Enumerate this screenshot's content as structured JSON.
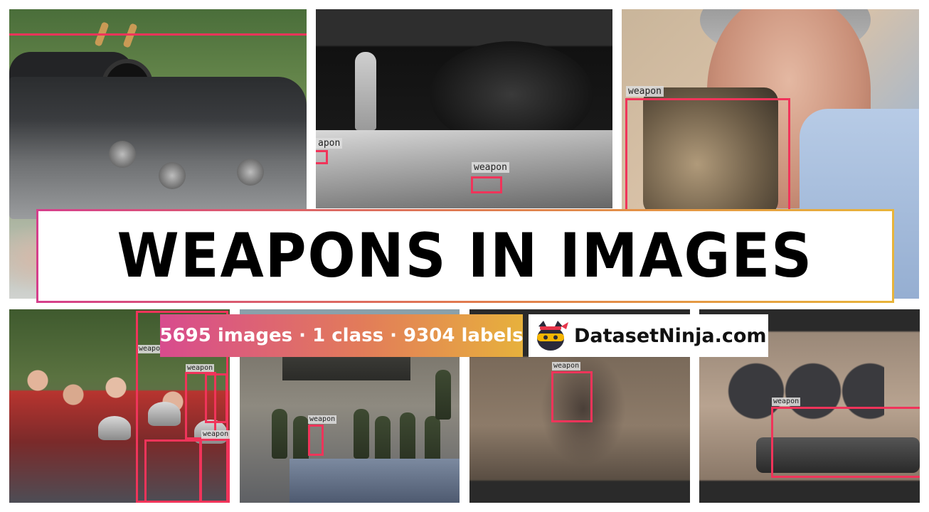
{
  "title": "WEAPONS IN IMAGES",
  "stats": "5695 images · 1 class · 9304 labels",
  "brand": {
    "name": "DatasetNinja.com",
    "logo_icon": "ninja-cat-icon"
  },
  "annotation_label": "weapon",
  "annotation_label_partial": "apon",
  "colors": {
    "box": "#f0345a",
    "gradient_start": "#d84b8e",
    "gradient_end": "#e7b13c"
  }
}
